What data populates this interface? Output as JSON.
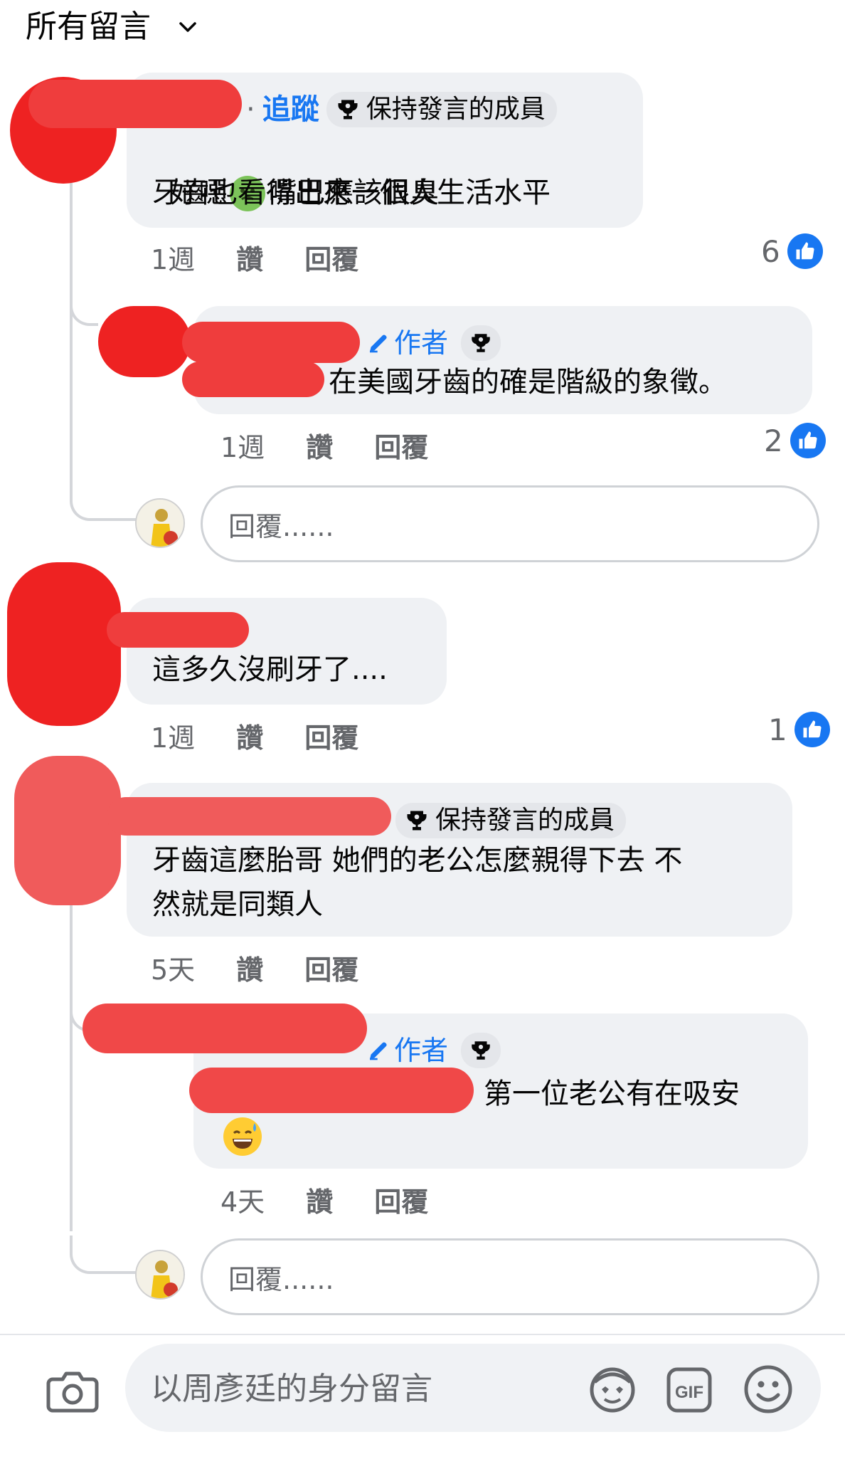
{
  "header": {
    "title": "所有留言"
  },
  "comments": [
    {
      "follow_label": "追蹤",
      "badge": "保持發言的成員",
      "text_line1": "好噁",
      "text_line1b": "嘴巴應該很臭",
      "text_line2": "牙齒也看得出來一個人生活水平",
      "emoji": "nauseated-face",
      "time": "1週",
      "like_label": "讚",
      "reply_label": "回覆",
      "likes": "6"
    },
    {
      "author_label": "作者",
      "text": "在美國牙齒的確是階級的象徵。",
      "time": "1週",
      "like_label": "讚",
      "reply_label": "回覆",
      "likes": "2"
    },
    {
      "text": "這多久沒刷牙了....",
      "time": "1週",
      "like_label": "讚",
      "reply_label": "回覆",
      "likes": "1"
    },
    {
      "badge": "保持發言的成員",
      "text_line1": "牙齒這麼胎哥 她們的老公怎麼親得下去 不",
      "text_line2": "然就是同類人",
      "time": "5天",
      "like_label": "讚",
      "reply_label": "回覆"
    },
    {
      "author_label": "作者",
      "text": "第一位老公有在吸安",
      "emoji": "grinning-face-with-sweat",
      "time": "4天",
      "like_label": "讚",
      "reply_label": "回覆"
    }
  ],
  "reply_inputs": [
    {
      "placeholder": "回覆......"
    },
    {
      "placeholder": "回覆......"
    }
  ],
  "composer": {
    "placeholder": "以周彥廷的身分留言"
  },
  "colors": {
    "accent": "#1877f2",
    "bubble": "#eff1f4",
    "redaction": "#ef3d3d"
  }
}
